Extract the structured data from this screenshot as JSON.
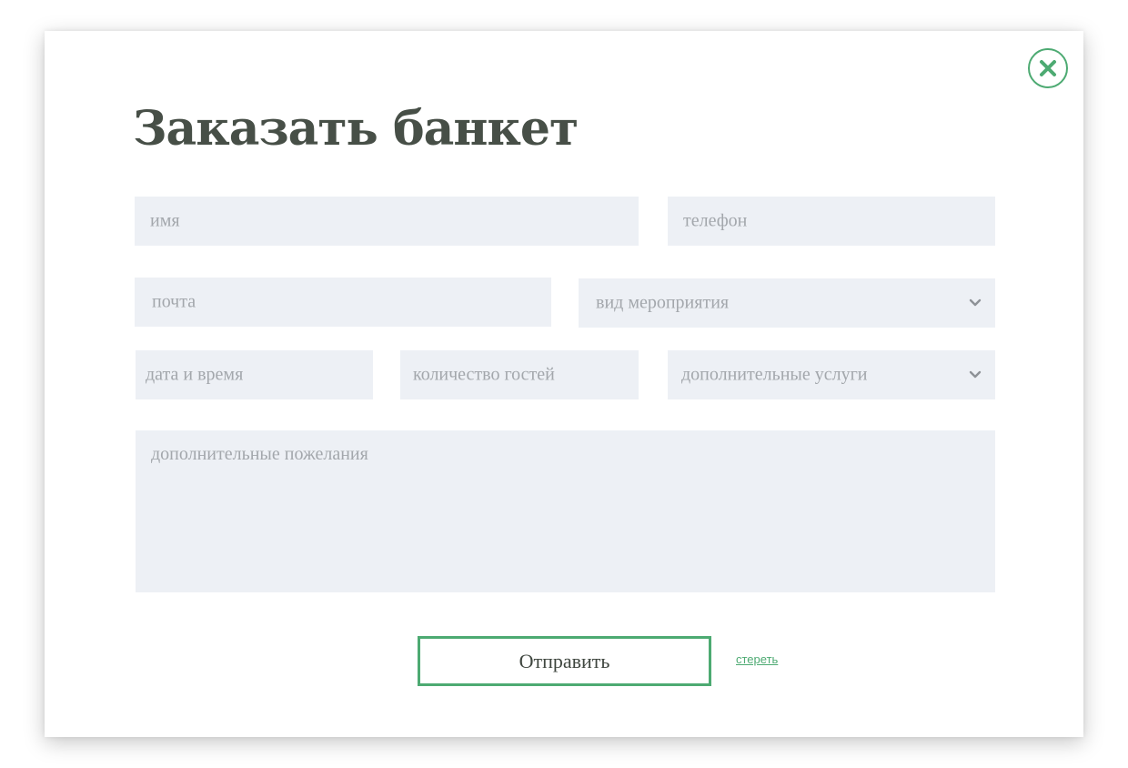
{
  "modal": {
    "title": "Заказать банкет",
    "close_icon": "close-icon"
  },
  "form": {
    "name_placeholder": "имя",
    "phone_placeholder": "телефон",
    "email_placeholder": "почта",
    "event_type_placeholder": "вид мероприятия",
    "datetime_placeholder": "дата и время",
    "guests_placeholder": "количество гостей",
    "extra_services_placeholder": "дополнительные услуги",
    "wishes_placeholder": "дополнительные пожелания",
    "dropdown_icon": "chevron-down-icon"
  },
  "actions": {
    "submit_label": "Отправить",
    "clear_label": "стереть"
  },
  "colors": {
    "accent": "#4daa72",
    "title": "#474f47",
    "field_bg": "#edf0f5",
    "placeholder": "#a3a7ac"
  }
}
